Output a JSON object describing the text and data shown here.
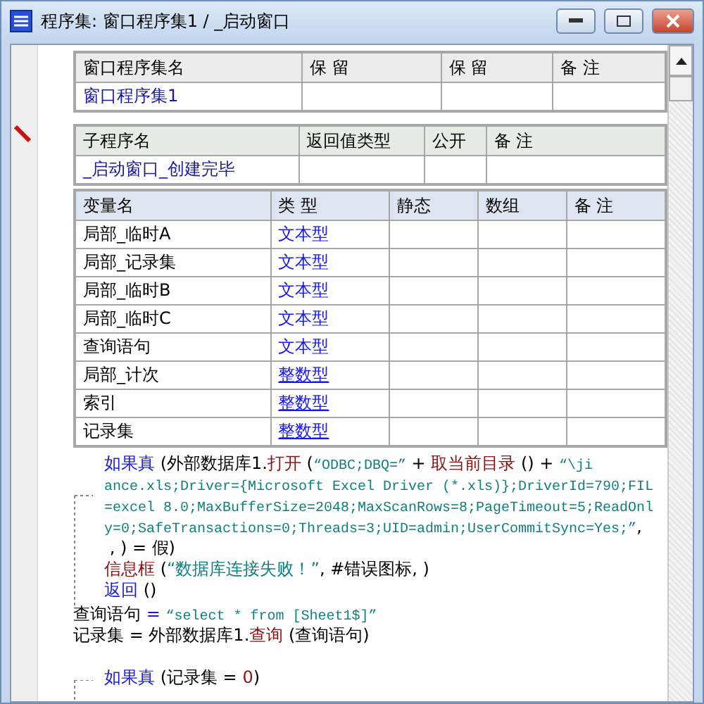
{
  "window": {
    "title": "程序集: 窗口程序集1 / _启动窗口"
  },
  "program_set_table": {
    "columns": [
      "窗口程序集名",
      "保 留",
      "保 留",
      "备 注"
    ],
    "rows": [
      [
        "窗口程序集1",
        "",
        "",
        ""
      ]
    ]
  },
  "subroutine_table": {
    "columns": [
      "子程序名",
      "返回值类型",
      "公开",
      "备 注"
    ],
    "rows": [
      [
        "_启动窗口_创建完毕",
        "",
        "",
        ""
      ]
    ]
  },
  "variable_table": {
    "columns": [
      "变量名",
      "类 型",
      "静态",
      "数组",
      "备 注"
    ],
    "rows": [
      {
        "name": "局部_临时A",
        "type": "文本型",
        "underlined": false
      },
      {
        "name": "局部_记录集",
        "type": "文本型",
        "underlined": false
      },
      {
        "name": "局部_临时B",
        "type": "文本型",
        "underlined": false
      },
      {
        "name": "局部_临时C",
        "type": "文本型",
        "underlined": false
      },
      {
        "name": "查询语句",
        "type": "文本型",
        "underlined": false
      },
      {
        "name": "局部_计次",
        "type": "整数型",
        "underlined": true
      },
      {
        "name": "索引",
        "type": "整数型",
        "underlined": true
      },
      {
        "name": "记录集",
        "type": "整数型",
        "underlined": true
      }
    ]
  },
  "code": {
    "blocks": [
      {
        "kind": "if",
        "lines": [
          [
            {
              "t": "如果真",
              "kind": "keyword"
            },
            {
              "t": " (外部数据库1.",
              "kind": "plain"
            },
            {
              "t": "打开",
              "kind": "func"
            },
            {
              "t": " (",
              "kind": "plain"
            },
            {
              "t": "“ODBC;DBQ=”",
              "kind": "string"
            },
            {
              "t": " + ",
              "kind": "plain"
            },
            {
              "t": "取当前目录",
              "kind": "func"
            },
            {
              "t": " () + ",
              "kind": "plain"
            },
            {
              "t": "“\\ji",
              "kind": "string"
            }
          ],
          [
            {
              "t": "ance.xls;Driver={Microsoft Excel Driver (*.xls)};DriverId=790;FIL",
              "kind": "string"
            }
          ],
          [
            {
              "t": "=excel 8.0;MaxBufferSize=2048;MaxScanRows=8;PageTimeout=5;ReadOnl",
              "kind": "string"
            }
          ],
          [
            {
              "t": "y=0;SafeTransactions=0;Threads=3;UID=admin;UserCommitSync=Yes;”",
              "kind": "string"
            },
            {
              "t": ",",
              "kind": "plain"
            }
          ],
          [
            {
              "t": " , ) = 假)",
              "kind": "plain"
            }
          ],
          [
            {
              "t": "信息框",
              "kind": "func"
            },
            {
              "t": " (",
              "kind": "plain"
            },
            {
              "t": "“数据库连接失败！”",
              "kind": "string"
            },
            {
              "t": ", #错误图标, )",
              "kind": "plain"
            }
          ],
          [
            {
              "t": "返回",
              "kind": "keyword"
            },
            {
              "t": " ()",
              "kind": "plain"
            }
          ]
        ]
      },
      {
        "kind": "plain",
        "lines": [
          [
            {
              "t": "查询语句",
              "kind": "plain"
            },
            {
              "t": " = ",
              "kind": "keyword"
            },
            {
              "t": "“select * from [Sheet1$]”",
              "kind": "string"
            }
          ],
          [
            {
              "t": "记录集 = 外部数据库1.",
              "kind": "plain"
            },
            {
              "t": "查询",
              "kind": "func"
            },
            {
              "t": " (查询语句)",
              "kind": "plain"
            }
          ]
        ]
      },
      {
        "kind": "if",
        "lines": [
          [
            {
              "t": "如果真",
              "kind": "keyword"
            },
            {
              "t": " (记录集 = ",
              "kind": "plain"
            },
            {
              "t": "0",
              "kind": "number"
            },
            {
              "t": ")",
              "kind": "plain"
            }
          ]
        ]
      }
    ]
  }
}
